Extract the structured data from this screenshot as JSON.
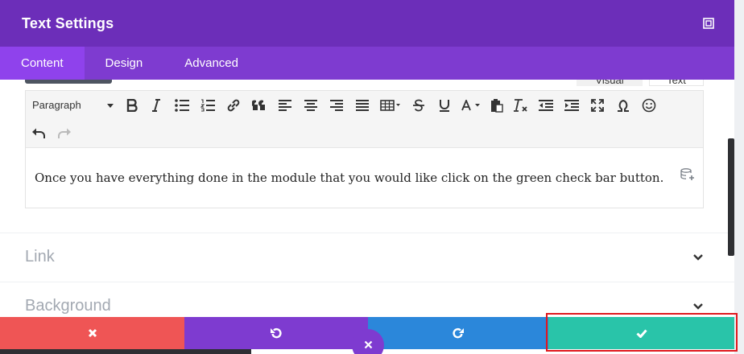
{
  "modal": {
    "title": "Text Settings",
    "tabs": [
      {
        "label": "Content",
        "active": true
      },
      {
        "label": "Design",
        "active": false
      },
      {
        "label": "Advanced",
        "active": false
      }
    ]
  },
  "editor": {
    "mode_tabs": {
      "visual": "Visual",
      "text": "Text"
    },
    "format_select": "Paragraph",
    "toolbar_icons": [
      "bold-icon",
      "italic-icon",
      "bullet-list-icon",
      "numbered-list-icon",
      "link-icon",
      "blockquote-icon",
      "align-left-icon",
      "align-center-icon",
      "align-right-icon",
      "align-justify-icon",
      "table-icon",
      "strikethrough-icon",
      "underline-icon",
      "text-color-icon",
      "paste-icon",
      "clear-formatting-icon",
      "outdent-icon",
      "indent-icon",
      "fullscreen-icon",
      "special-character-icon",
      "emoji-icon",
      "undo-icon",
      "redo-icon"
    ],
    "body_text": "Once you have everything done in the module that you would like click on the green check bar button."
  },
  "sections": [
    {
      "label": "Link"
    },
    {
      "label": "Background"
    }
  ],
  "footer": {
    "colors": {
      "cancel": "#ef5555",
      "undo": "#7e3bd0",
      "redo": "#2b87da",
      "save": "#29c4a9"
    }
  },
  "colors": {
    "header": "#6c2eb9",
    "tabs": "#7e3bd0",
    "active_tab": "#8f42ec",
    "highlight": "#e0191e"
  }
}
